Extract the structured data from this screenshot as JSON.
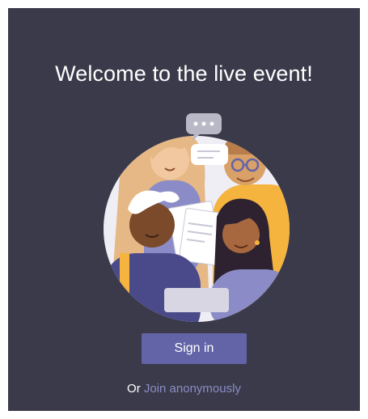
{
  "welcome": {
    "title": "Welcome to the live event!"
  },
  "illustration": {
    "icon": "people-chat-illustration",
    "colors": {
      "background_circle": "#f0eef5",
      "yellow": "#f4b43e",
      "purple": "#6264a7",
      "light_purple": "#8b8cc7"
    }
  },
  "actions": {
    "signin_label": "Sign in",
    "or_text": "Or",
    "join_label": "Join anonymously"
  },
  "colors": {
    "panel_bg": "#3b3a4a",
    "button_bg": "#6264a7",
    "link": "#8b8cc7"
  }
}
